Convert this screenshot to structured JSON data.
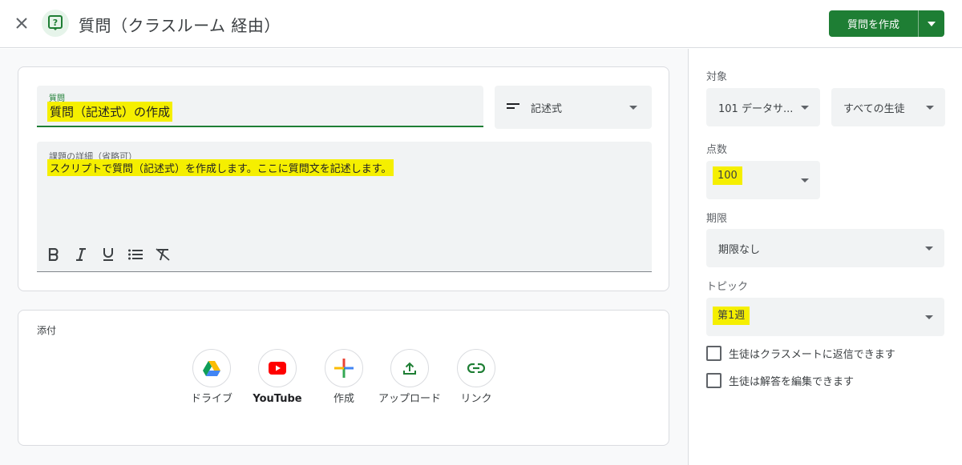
{
  "header": {
    "title": "質問（クラスルーム 経由）",
    "create_button": "質問を作成",
    "accent_color": "#1e7e34"
  },
  "question": {
    "title_label": "質問",
    "title_value": "質問（記述式）の作成",
    "type_value": "記述式",
    "details_label": "課題の詳細（省略可）",
    "details_value": "スクリプトで質問（記述式）を作成します。ここに質問文を記述します。",
    "toolbar": [
      "bold-icon",
      "italic-icon",
      "underline-icon",
      "bulleted-list-icon",
      "clear-format-icon"
    ]
  },
  "attach": {
    "label": "添付",
    "items": [
      {
        "label": "ドライブ",
        "icon": "google-drive-icon"
      },
      {
        "label": "YouTube",
        "icon": "youtube-icon"
      },
      {
        "label": "作成",
        "icon": "plus-icon"
      },
      {
        "label": "アップロード",
        "icon": "upload-icon"
      },
      {
        "label": "リンク",
        "icon": "link-icon"
      }
    ]
  },
  "settings": {
    "target_label": "対象",
    "class_value": "101 データサ...",
    "students_value": "すべての生徒",
    "points_label": "点数",
    "points_value": "100",
    "due_label": "期限",
    "due_value": "期限なし",
    "topic_label": "トピック",
    "topic_value": "第1週",
    "check_reply": "生徒はクラスメートに返信できます",
    "check_edit": "生徒は解答を編集できます"
  },
  "highlight_color": "#f5ef00"
}
